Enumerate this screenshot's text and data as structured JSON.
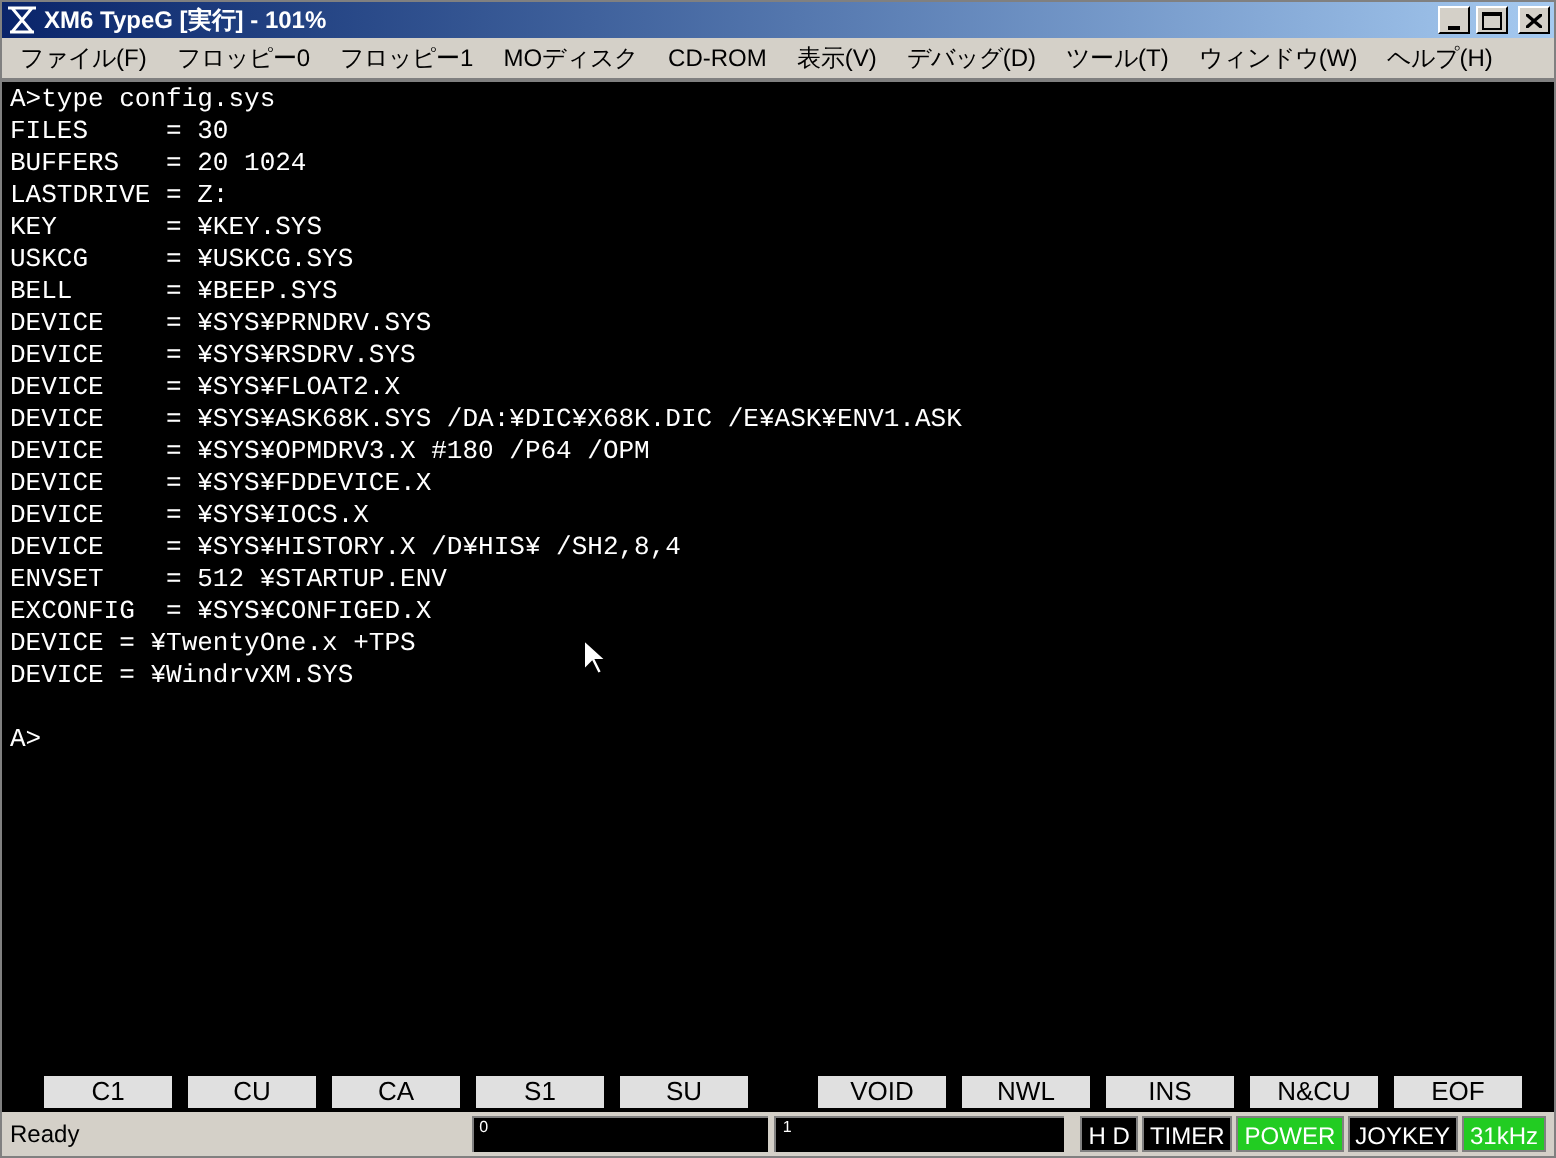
{
  "window": {
    "title": "XM6 TypeG [実行] - 101%"
  },
  "menu": [
    "ファイル(F)",
    "フロッピー0",
    "フロッピー1",
    "MOディスク",
    "CD-ROM",
    "表示(V)",
    "デバッグ(D)",
    "ツール(T)",
    "ウィンドウ(W)",
    "ヘルプ(H)"
  ],
  "terminal": {
    "lines": [
      "A>type config.sys",
      "FILES     = 30",
      "BUFFERS   = 20 1024",
      "LASTDRIVE = Z:",
      "KEY       = ¥KEY.SYS",
      "USKCG     = ¥USKCG.SYS",
      "BELL      = ¥BEEP.SYS",
      "DEVICE    = ¥SYS¥PRNDRV.SYS",
      "DEVICE    = ¥SYS¥RSDRV.SYS",
      "DEVICE    = ¥SYS¥FLOAT2.X",
      "DEVICE    = ¥SYS¥ASK68K.SYS /DA:¥DIC¥X68K.DIC /E¥ASK¥ENV1.ASK",
      "DEVICE    = ¥SYS¥OPMDRV3.X #180 /P64 /OPM",
      "DEVICE    = ¥SYS¥FDDEVICE.X",
      "DEVICE    = ¥SYS¥IOCS.X",
      "DEVICE    = ¥SYS¥HISTORY.X /D¥HIS¥ /SH2,8,4",
      "ENVSET    = 512 ¥STARTUP.ENV",
      "EXCONFIG  = ¥SYS¥CONFIGED.X",
      "DEVICE = ¥TwentyOne.x +TPS",
      "DEVICE = ¥WindrvXM.SYS"
    ],
    "prompt": "A>"
  },
  "function_keys": [
    [
      "C1",
      "CU",
      "CA",
      "S1",
      "SU"
    ],
    [
      "VOID",
      "NWL",
      "INS",
      "N&CU",
      "EOF"
    ]
  ],
  "status_bar": {
    "message": "Ready",
    "drive_0": "0",
    "drive_1": "1",
    "indicators": [
      {
        "label": "H D",
        "on": false
      },
      {
        "label": "TIMER",
        "on": false
      },
      {
        "label": "POWER",
        "on": true
      },
      {
        "label": "JOYKEY",
        "on": false
      },
      {
        "label": "31kHz",
        "on": true
      }
    ]
  }
}
